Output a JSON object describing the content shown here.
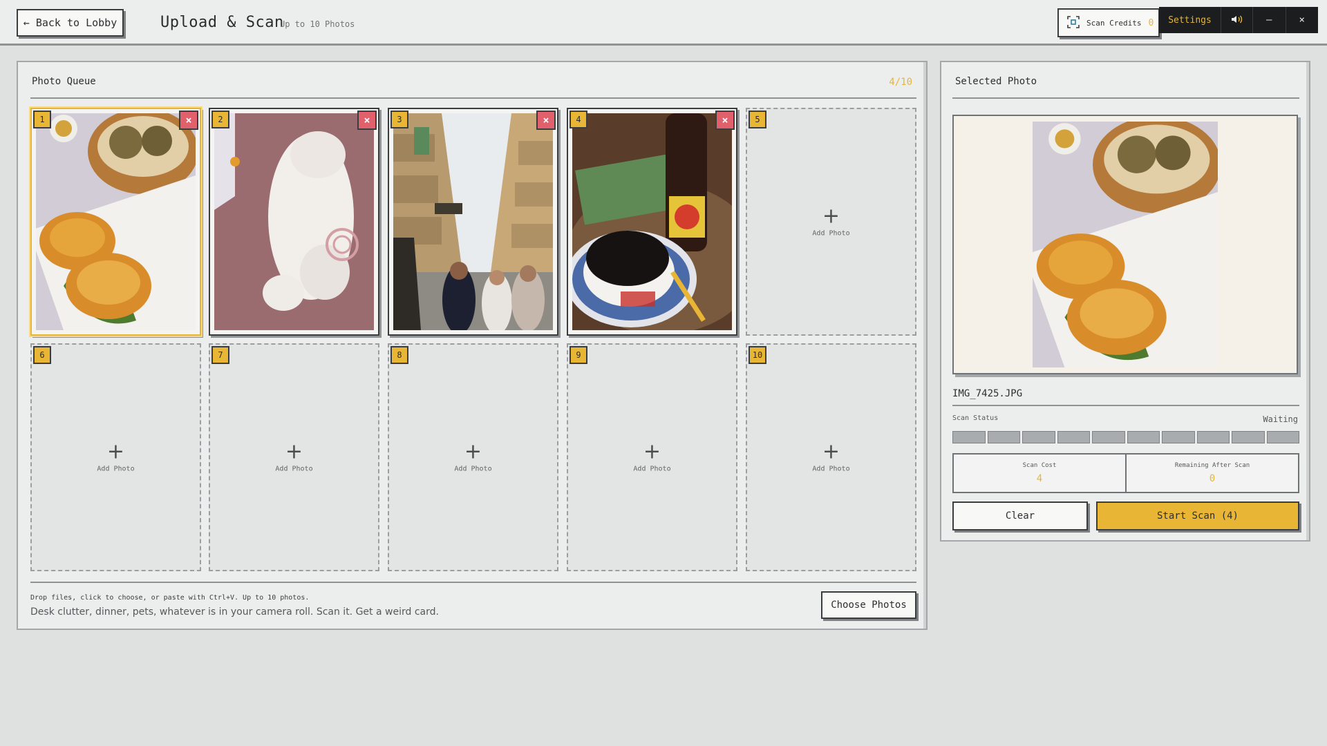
{
  "topbar": {
    "back_label": "← Back to Lobby",
    "title": "Upload & Scan",
    "subtitle": "Up to 10 Photos",
    "credits_label": "Scan Credits",
    "credits_value": "0",
    "settings_label": "Settings",
    "sound_icon": "speaker-icon",
    "minimize_label": "–",
    "close_label": "×"
  },
  "queue": {
    "title": "Photo Queue",
    "count": "4/10",
    "slots": [
      {
        "num": "1",
        "filled": true,
        "selected": true,
        "photo": "dim sum with sesame pastries"
      },
      {
        "num": "2",
        "filled": true,
        "photo": "white cat lying on floor"
      },
      {
        "num": "3",
        "filled": true,
        "photo": "narrow street with pedestrians"
      },
      {
        "num": "4",
        "filled": true,
        "photo": "coffee cup and drink bottle"
      },
      {
        "num": "5",
        "filled": false,
        "add_label": "Add Photo"
      },
      {
        "num": "6",
        "filled": false,
        "add_label": "Add Photo"
      },
      {
        "num": "7",
        "filled": false,
        "add_label": "Add Photo"
      },
      {
        "num": "8",
        "filled": false,
        "add_label": "Add Photo"
      },
      {
        "num": "9",
        "filled": false,
        "add_label": "Add Photo"
      },
      {
        "num": "10",
        "filled": false,
        "add_label": "Add Photo"
      }
    ],
    "remove_label": "×",
    "add_plus": "+",
    "hint_line1": "Drop files, click to choose, or paste with Ctrl+V. Up to 10 photos.",
    "hint_line2": "Desk clutter, dinner, pets, whatever is in your camera roll. Scan it. Get a weird card.",
    "choose_label": "Choose Photos"
  },
  "selected": {
    "title": "Selected Photo",
    "filename": "IMG_7425.JPG",
    "status_label": "Scan Status",
    "status_value": "Waiting",
    "progress_segments": 10,
    "progress_filled": 0,
    "cost_label": "Scan Cost",
    "cost_value": "4",
    "remaining_label": "Remaining After Scan",
    "remaining_value": "0",
    "clear_label": "Clear",
    "scan_label": "Start Scan (4)"
  },
  "colors": {
    "accent": "#e8b534",
    "remove": "#e0606b",
    "background": "#dfe1e0",
    "panel": "#eceeed",
    "dark": "#1c1d1f"
  }
}
